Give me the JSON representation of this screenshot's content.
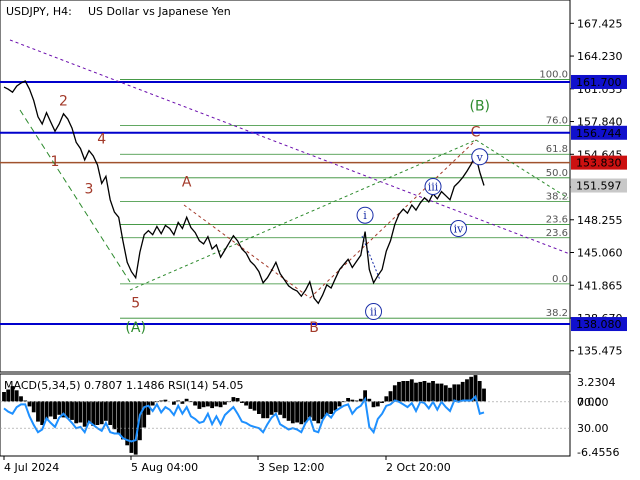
{
  "header": {
    "symbol": "USDJPY, H4:",
    "description": "US Dollar vs Japanese Yen"
  },
  "colors": {
    "candle": "#000000",
    "blue_line": "#0000cc",
    "brown_line": "#a0522d",
    "green_line": "#2e8b2e",
    "purple_line": "#6a0dad",
    "wave_label_red": "#a33a2a",
    "wave_label_green": "#2e8b2e",
    "wave_label_blue": "#1a2ea8",
    "macd_bars": "#000000",
    "macd_fill": "#a33a2a",
    "rsi_line": "#1e90ff",
    "price_tag_blue": "#1010cc",
    "price_tag_red": "#cc1010",
    "price_tag_gray": "#c8c8c8"
  },
  "y_axis_ticks": [
    "167.425",
    "164.230",
    "161.035",
    "157.840",
    "154.645",
    "151.450",
    "148.255",
    "145.060",
    "141.865",
    "138.670",
    "135.475"
  ],
  "x_axis_ticks": [
    "4 Jul 2024",
    "5 Aug 04:00",
    "3 Sep 12:00",
    "2 Oct 20:00"
  ],
  "price_tags": [
    {
      "id": "tag-161700",
      "label": "161.700",
      "kind": "blue",
      "price": 161.7
    },
    {
      "id": "tag-156744",
      "label": "156.744",
      "kind": "blue",
      "price": 156.744
    },
    {
      "id": "tag-153830",
      "label": "153.830",
      "kind": "red",
      "price": 153.83
    },
    {
      "id": "tag-151597",
      "label": "151.597",
      "kind": "gray",
      "price": 151.597
    },
    {
      "id": "tag-138080",
      "label": "138.080",
      "kind": "blue",
      "price": 138.08
    }
  ],
  "horizontal_levels": [
    {
      "price": 161.7,
      "color": "blue_line",
      "width": 2
    },
    {
      "price": 156.744,
      "color": "blue_line",
      "width": 2
    },
    {
      "price": 153.83,
      "color": "brown_line",
      "width": 1.5
    },
    {
      "price": 138.08,
      "color": "blue_line",
      "width": 2
    }
  ],
  "fib_levels": [
    {
      "label": "100.0",
      "price": 161.95
    },
    {
      "label": "76.0",
      "price": 157.45
    },
    {
      "label": "61.8",
      "price": 154.65
    },
    {
      "label": "50.0",
      "price": 152.35
    },
    {
      "label": "38.2",
      "price": 150.05
    },
    {
      "label": "23.6",
      "price": 147.8
    },
    {
      "label": "23.6",
      "price": 146.5
    },
    {
      "label": "0.0",
      "price": 142.0
    },
    {
      "label": "38.2",
      "price": 138.65
    }
  ],
  "wave_labels": [
    {
      "text": "2",
      "style": "red",
      "date_index": 14,
      "price": 159.4
    },
    {
      "text": "1",
      "style": "red",
      "date_index": 12,
      "price": 153.5
    },
    {
      "text": "3",
      "style": "red",
      "date_index": 20,
      "price": 150.8
    },
    {
      "text": "4",
      "style": "red",
      "date_index": 23,
      "price": 155.7
    },
    {
      "text": "5",
      "style": "red",
      "date_index": 31,
      "price": 139.7
    },
    {
      "text": "(A)",
      "style": "green",
      "date_index": 31,
      "price": 137.3
    },
    {
      "text": "A",
      "style": "red",
      "date_index": 43,
      "price": 151.5
    },
    {
      "text": "B",
      "style": "red",
      "date_index": 73,
      "price": 137.3
    },
    {
      "text": "(B)",
      "style": "green",
      "date_index": 112,
      "price": 158.9
    },
    {
      "text": "C",
      "style": "red",
      "date_index": 111,
      "price": 156.4
    }
  ],
  "circle_labels": [
    {
      "text": "i",
      "date_index": 85,
      "price": 148.7
    },
    {
      "text": "ii",
      "date_index": 87,
      "price": 139.3
    },
    {
      "text": "iii",
      "date_index": 101,
      "price": 151.5
    },
    {
      "text": "iv",
      "date_index": 107,
      "price": 147.4
    },
    {
      "text": "v",
      "date_index": 112,
      "price": 154.4
    }
  ],
  "macd_panel": {
    "label": "MACD(5,34,5) 0.7807 1.1486 RSI(14) 54.05",
    "ticks": [
      "3.2304",
      "70.00",
      "0.00",
      "30.00",
      "-6.4556"
    ]
  },
  "chart_data": {
    "type": "line",
    "title": "USDJPY, H4: US Dollar vs Japanese Yen",
    "xlabel": "",
    "ylabel": "",
    "ylim": [
      133.4,
      169.7
    ],
    "grid": false,
    "x_range_dates": [
      "4 Jul 2024",
      "2 Oct 20:00"
    ],
    "series": [
      {
        "values": [
          161.2,
          161.0,
          160.7,
          161.3,
          161.6,
          161.8,
          161.0,
          159.9,
          158.3,
          157.6,
          158.7,
          157.8,
          156.9,
          157.6,
          158.6,
          158.1,
          157.2,
          155.8,
          155.2,
          154.1,
          155.0,
          154.5,
          153.6,
          151.8,
          152.5,
          150.2,
          149.0,
          148.5,
          146.2,
          144.1,
          143.2,
          142.6,
          145.1,
          146.8,
          147.2,
          146.8,
          147.6,
          146.9,
          147.7,
          147.4,
          146.8,
          148.0,
          147.4,
          148.5,
          147.5,
          147.0,
          146.2,
          145.9,
          146.6,
          145.4,
          145.8,
          144.6,
          145.3,
          146.0,
          146.7,
          146.2,
          145.4,
          145.0,
          144.2,
          143.8,
          143.2,
          142.1,
          142.6,
          143.3,
          144.1,
          143.0,
          142.4,
          141.8,
          141.5,
          141.3,
          140.8,
          141.4,
          142.2,
          140.6,
          140.1,
          140.9,
          141.9,
          141.6,
          142.5,
          143.4,
          143.9,
          144.4,
          143.6,
          144.2,
          144.8,
          147.1,
          143.4,
          142.1,
          142.8,
          143.4,
          145.2,
          146.2,
          147.8,
          148.8,
          149.3,
          148.9,
          149.7,
          149.2,
          149.9,
          150.4,
          150.0,
          150.8,
          150.3,
          151.0,
          150.6,
          150.2,
          151.5,
          151.9,
          152.4,
          153.0,
          153.7,
          154.6,
          152.9,
          151.6
        ],
        "color": "#000000"
      }
    ],
    "indicators": {
      "macd_histogram": [
        1.1,
        1.4,
        1.8,
        1.3,
        0.6,
        0.1,
        -0.6,
        -1.3,
        -2.4,
        -2.8,
        -2.2,
        -1.8,
        -2.1,
        -1.6,
        -1.9,
        -2.0,
        -2.2,
        -2.6,
        -2.5,
        -3.0,
        -2.6,
        -2.9,
        -2.8,
        -2.7,
        -2.3,
        -2.8,
        -3.3,
        -3.9,
        -4.5,
        -5.2,
        -6.1,
        -6.3,
        -4.6,
        -3.1,
        -1.6,
        -0.5,
        -0.1,
        0.1,
        0.2,
        0.0,
        -0.4,
        0.1,
        -0.3,
        0.3,
        -0.1,
        -0.5,
        -0.9,
        -0.7,
        -0.6,
        -0.8,
        -0.6,
        -0.7,
        -0.4,
        -0.1,
        0.5,
        0.4,
        -0.2,
        -0.5,
        -0.9,
        -1.1,
        -1.5,
        -2.0,
        -2.0,
        -1.6,
        -1.3,
        -1.6,
        -2.0,
        -2.3,
        -2.6,
        -2.5,
        -2.7,
        -2.5,
        -1.9,
        -2.3,
        -2.6,
        -2.1,
        -1.6,
        -1.5,
        -1.1,
        -0.6,
        -0.1,
        0.4,
        0.2,
        0.1,
        0.3,
        1.3,
        0.3,
        -0.7,
        -0.6,
        -0.2,
        0.6,
        1.2,
        1.9,
        2.3,
        2.4,
        2.4,
        2.6,
        2.2,
        2.3,
        2.4,
        2.2,
        2.4,
        2.1,
        2.1,
        1.9,
        1.6,
        2.0,
        2.0,
        2.3,
        2.6,
        2.9,
        3.1,
        2.4,
        1.5
      ],
      "rsi": [
        60,
        55,
        52,
        62,
        66,
        66,
        48,
        35,
        24,
        28,
        45,
        38,
        32,
        46,
        52,
        45,
        38,
        30,
        32,
        24,
        40,
        35,
        30,
        26,
        38,
        24,
        22,
        22,
        15,
        12,
        10,
        12,
        50,
        62,
        64,
        56,
        66,
        54,
        62,
        58,
        50,
        64,
        52,
        62,
        48,
        44,
        38,
        40,
        52,
        36,
        48,
        36,
        50,
        56,
        62,
        52,
        40,
        38,
        34,
        32,
        30,
        24,
        36,
        46,
        52,
        36,
        32,
        28,
        30,
        28,
        24,
        38,
        46,
        26,
        24,
        42,
        52,
        46,
        56,
        60,
        64,
        66,
        52,
        60,
        64,
        74,
        32,
        24,
        44,
        52,
        64,
        66,
        72,
        70,
        66,
        62,
        68,
        56,
        70,
        68,
        60,
        70,
        58,
        70,
        62,
        56,
        72,
        70,
        72,
        72,
        72,
        78,
        52,
        54
      ]
    }
  }
}
